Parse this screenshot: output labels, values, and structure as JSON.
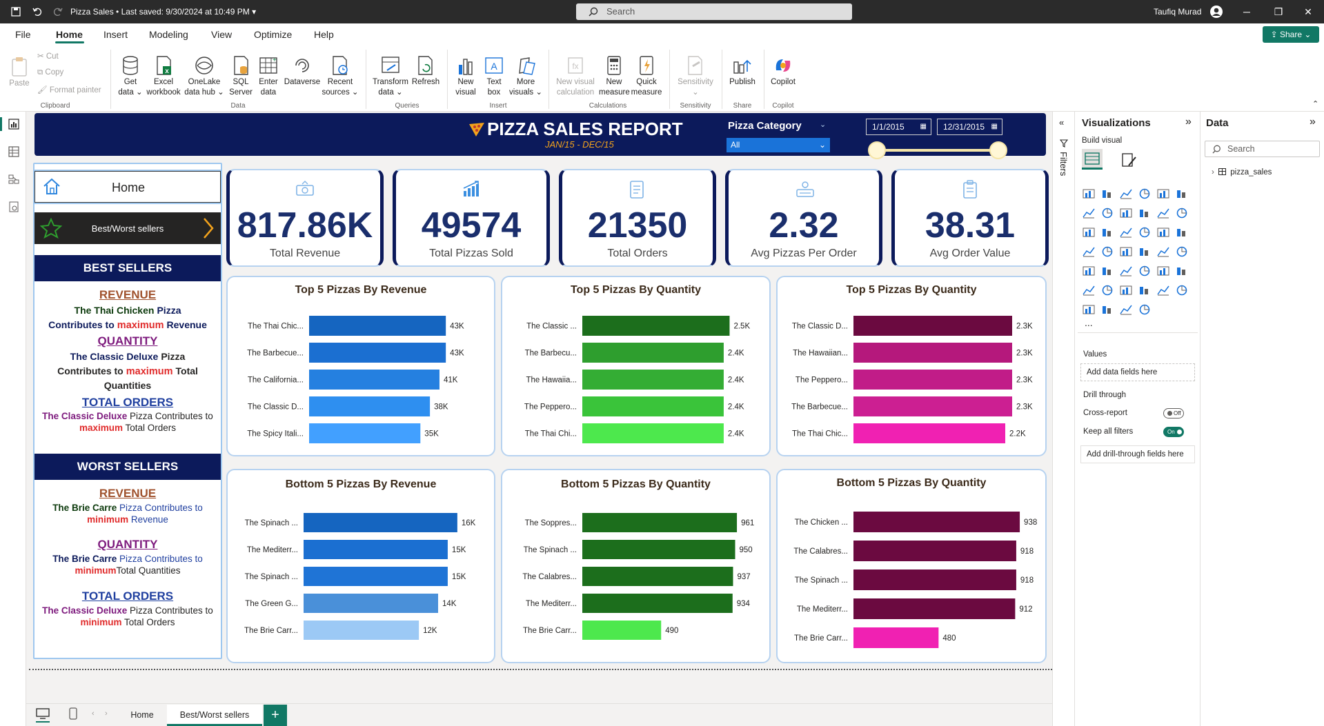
{
  "titlebar": {
    "doc_title": "Pizza Sales",
    "saved": "Last saved: 9/30/2024 at 10:49 PM",
    "search_placeholder": "Search",
    "user": "Taufiq Murad"
  },
  "menu": [
    "File",
    "Home",
    "Insert",
    "Modeling",
    "View",
    "Optimize",
    "Help"
  ],
  "share_label": "Share",
  "ribbon": {
    "paste": "Paste",
    "cut": "Cut",
    "copy": "Copy",
    "format_painter": "Format painter",
    "clipboard": "Clipboard",
    "get_data": [
      "Get",
      "data ⌄"
    ],
    "excel": [
      "Excel",
      "workbook"
    ],
    "onelake": [
      "OneLake",
      "data hub ⌄"
    ],
    "sql": [
      "SQL",
      "Server"
    ],
    "enter": [
      "Enter",
      "data"
    ],
    "dataverse": "Dataverse",
    "recent": [
      "Recent",
      "sources ⌄"
    ],
    "data_group": "Data",
    "transform": [
      "Transform",
      "data ⌄"
    ],
    "refresh": "Refresh",
    "queries_group": "Queries",
    "new_visual": [
      "New",
      "visual"
    ],
    "text_box": [
      "Text",
      "box"
    ],
    "more_visuals": [
      "More",
      "visuals ⌄"
    ],
    "insert_group": "Insert",
    "new_visual_calc": [
      "New visual",
      "calculation"
    ],
    "new_measure": [
      "New",
      "measure"
    ],
    "quick_measure": [
      "Quick",
      "measure"
    ],
    "calc_group": "Calculations",
    "sensitivity": [
      "Sensitivity",
      "⌄"
    ],
    "sensitivity_group": "Sensitivity",
    "publish": "Publish",
    "share_group": "Share",
    "copilot": "Copilot",
    "copilot_group": "Copilot"
  },
  "report": {
    "title": "PIZZA SALES REPORT",
    "subtitle": "JAN/15 - DEC/15",
    "category_label": "Pizza Category",
    "category_value": "All",
    "date_start": "1/1/2015",
    "date_end": "12/31/2015"
  },
  "nav": {
    "home": "Home",
    "best_worst": "Best/Worst sellers"
  },
  "best_sellers": {
    "heading": "BEST SELLERS",
    "revenue_label": "REVENUE",
    "revenue_name": "The Thai Chicken",
    "revenue_word": "Pizza",
    "revenue_line2a": "Contributes to",
    "revenue_line2b": "maximum",
    "revenue_line2c": "Revenue",
    "quantity_label": "QUANTITY",
    "quantity_name": "The Classic Deluxe",
    "quantity_word": "Pizza",
    "quantity_line2a": "Contributes to",
    "quantity_line2b": "maximum",
    "quantity_line2c": "Total",
    "quantity_line3": "Quantities",
    "orders_label": "TOTAL ORDERS",
    "orders_name": "The Classic Deluxe",
    "orders_rest": "Pizza Contributes to",
    "orders_line2a": "maximum",
    "orders_line2b": "Total Orders"
  },
  "worst_sellers": {
    "heading": "WORST SELLERS",
    "revenue_label": "REVENUE",
    "revenue_name": "The Brie Carre",
    "revenue_rest": "Pizza Contributes to",
    "revenue_line2a": "minimum",
    "revenue_line2b": "Revenue",
    "quantity_label": "QUANTITY",
    "quantity_name": "The Brie Carre",
    "quantity_rest": "Pizza Contributes to",
    "quantity_line2a": "minimum",
    "quantity_line2b": "Total Quantities",
    "orders_label": "TOTAL ORDERS",
    "orders_name": "The Classic Deluxe",
    "orders_rest": "Pizza Contributes to",
    "orders_line2a": "minimum",
    "orders_line2b": "Total Orders"
  },
  "kpis": [
    {
      "value": "817.86K",
      "label": "Total Revenue"
    },
    {
      "value": "49574",
      "label": "Total Pizzas Sold"
    },
    {
      "value": "21350",
      "label": "Total Orders"
    },
    {
      "value": "2.32",
      "label": "Avg Pizzas Per Order"
    },
    {
      "value": "38.31",
      "label": "Avg Order Value"
    }
  ],
  "chart_data": [
    {
      "type": "bar",
      "title": "Top 5 Pizzas By Revenue",
      "categories": [
        "The Thai Chic...",
        "The Barbecue...",
        "The California...",
        "The Classic D...",
        "The Spicy Itali..."
      ],
      "values": [
        43,
        43,
        41,
        38,
        35
      ],
      "labels": [
        "43K",
        "43K",
        "41K",
        "38K",
        "35K"
      ],
      "xlim": [
        0,
        46
      ],
      "colors": [
        "#1565c0",
        "#1b6fd1",
        "#2580e0",
        "#2e8ff0",
        "#42a0ff"
      ]
    },
    {
      "type": "bar",
      "title": "Top 5 Pizzas By Quantity",
      "categories": [
        "The Classic ...",
        "The Barbecu...",
        "The Hawaiia...",
        "The Peppero...",
        "The Thai Chi..."
      ],
      "values": [
        2.5,
        2.4,
        2.4,
        2.4,
        2.4
      ],
      "labels": [
        "2.5K",
        "2.4K",
        "2.4K",
        "2.4K",
        "2.4K"
      ],
      "xlim": [
        0,
        2.6
      ],
      "colors": [
        "#1c6e1c",
        "#2e9e2e",
        "#34ad34",
        "#3ac43a",
        "#4de84d"
      ]
    },
    {
      "type": "bar",
      "title": "Top 5 Pizzas By Quantity",
      "categories": [
        "The Classic D...",
        "The Hawaiian...",
        "The Peppero...",
        "The Barbecue...",
        "The Thai Chic..."
      ],
      "values": [
        2.3,
        2.3,
        2.3,
        2.3,
        2.2
      ],
      "labels": [
        "2.3K",
        "2.3K",
        "2.3K",
        "2.3K",
        "2.2K"
      ],
      "xlim": [
        0,
        2.4
      ],
      "colors": [
        "#6b0a40",
        "#b5187c",
        "#c11c88",
        "#cc1f92",
        "#f021b2"
      ]
    },
    {
      "type": "bar",
      "title": "Bottom 5 Pizzas By Revenue",
      "categories": [
        "The Spinach ...",
        "The Mediterr...",
        "The Spinach ...",
        "The Green G...",
        "The Brie Carr..."
      ],
      "values": [
        16,
        15,
        15,
        14,
        12
      ],
      "labels": [
        "16K",
        "15K",
        "15K",
        "14K",
        "12K"
      ],
      "xlim": [
        0,
        16.8
      ],
      "colors": [
        "#1565c0",
        "#1b6fd1",
        "#1f74d6",
        "#4a90d9",
        "#9cc9f5"
      ]
    },
    {
      "type": "bar",
      "title": "Bottom 5 Pizzas By Quantity",
      "categories": [
        "The Soppres...",
        "The Spinach ...",
        "The Calabres...",
        "The Mediterr...",
        "The Brie Carr..."
      ],
      "values": [
        961,
        950,
        937,
        934,
        490
      ],
      "labels": [
        "961",
        "950",
        "937",
        "934",
        "490"
      ],
      "xlim": [
        0,
        995
      ],
      "colors": [
        "#1c6e1c",
        "#1c6e1c",
        "#1c6e1c",
        "#1c6e1c",
        "#4de84d"
      ]
    },
    {
      "type": "bar",
      "title": "Bottom 5 Pizzas By Quantity",
      "categories": [
        "The Chicken ...",
        "The Calabres...",
        "The Spinach ...",
        "The Mediterr...",
        "The Brie Carr..."
      ],
      "values": [
        938,
        918,
        918,
        912,
        480
      ],
      "labels": [
        "938",
        "918",
        "918",
        "912",
        "480"
      ],
      "xlim": [
        0,
        965
      ],
      "colors": [
        "#6b0a40",
        "#6b0a40",
        "#6b0a40",
        "#6b0a40",
        "#f021b2"
      ]
    }
  ],
  "filters_label": "Filters",
  "viz_pane": {
    "title": "Visualizations",
    "build_visual": "Build visual",
    "values": "Values",
    "add_fields": "Add data fields here",
    "drill": "Drill through",
    "cross_report": "Cross-report",
    "cross_state": "Off",
    "keep_filters": "Keep all filters",
    "keep_state": "On",
    "add_drill": "Add drill-through fields here",
    "more": "..."
  },
  "data_pane": {
    "title": "Data",
    "search_placeholder": "Search",
    "table": "pizza_sales"
  },
  "tabs": [
    "Home",
    "Best/Worst sellers"
  ],
  "colors": {
    "navy": "#0c1a5b",
    "accent": "#117865",
    "orange": "#f3a31c"
  }
}
